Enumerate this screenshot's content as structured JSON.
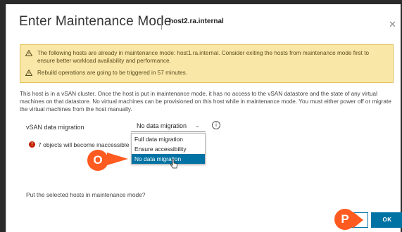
{
  "dialog": {
    "title": "Enter Maintenance Mode",
    "host": "host2.ra.internal",
    "close_icon": "close-icon"
  },
  "warnings": [
    {
      "icon": "warning-triangle-icon",
      "text": "The following hosts are already in maintenance mode: host1.ra.internal. Consider exiting the hosts from maintenance mode first to ensure better workload availability and performance."
    },
    {
      "icon": "warning-triangle-icon",
      "text": "Rebuild operations are going to be triggered in 57 minutes."
    }
  ],
  "body_text": "This host is in a vSAN cluster. Once the host is put in maintenance mode, it has no access to the vSAN datastore and the state of any virtual machines on that datastore. No virtual machines can be provisioned on this host while in maintenance mode. You must either power off or migrate the virtual machines from the host manually.",
  "migration": {
    "label": "vSAN data migration",
    "selected": "No data migration",
    "options": [
      "Full data migration",
      "Ensure accessibility",
      "No data migration"
    ],
    "selected_index": 2
  },
  "error_text": "7 objects will become inaccessible",
  "prompt": "Put the selected hosts in maintenance mode?",
  "badges": {
    "o": "O",
    "p": "P"
  },
  "buttons": {
    "ok": "OK"
  },
  "colors": {
    "accent": "#0072a3",
    "warning_bg": "#f9e7a8",
    "badge": "#ff5a1f",
    "error": "#c21d00"
  }
}
